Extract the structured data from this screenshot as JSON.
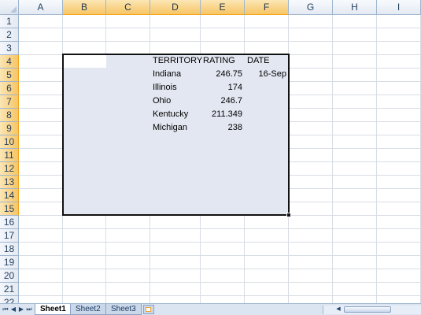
{
  "columns": [
    "A",
    "B",
    "C",
    "D",
    "E",
    "F",
    "G",
    "H",
    "I"
  ],
  "rows": [
    "1",
    "2",
    "3",
    "4",
    "5",
    "6",
    "7",
    "8",
    "9",
    "10",
    "11",
    "12",
    "13",
    "14",
    "15",
    "16",
    "17",
    "18",
    "19",
    "20",
    "21",
    "22"
  ],
  "headers": {
    "territory": "TERRITORY",
    "rating": "RATING",
    "date": "DATE"
  },
  "data": [
    {
      "territory": "Indiana",
      "rating": "246.75",
      "date": "16-Sep"
    },
    {
      "territory": "Illinois",
      "rating": "174",
      "date": ""
    },
    {
      "territory": "Ohio",
      "rating": "246.7",
      "date": ""
    },
    {
      "territory": "Kentucky",
      "rating": "211.349",
      "date": ""
    },
    {
      "territory": "Michigan",
      "rating": "238",
      "date": ""
    }
  ],
  "tabs": [
    "Sheet1",
    "Sheet2",
    "Sheet3"
  ],
  "active_tab": "Sheet1",
  "selected_columns": [
    "B",
    "C",
    "D",
    "E",
    "F"
  ],
  "selected_rows": [
    "4",
    "5",
    "6",
    "7",
    "8",
    "9",
    "10",
    "11",
    "12",
    "13",
    "14",
    "15"
  ],
  "colors": {
    "selection_fill": "#e3e7f1",
    "header_highlight": "#f7c565",
    "gridline": "#d8dde4"
  }
}
